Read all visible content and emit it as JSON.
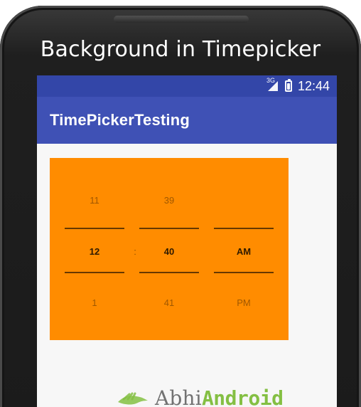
{
  "frame": {
    "title": "Background in Timepicker"
  },
  "status_bar": {
    "signal_label": "3G",
    "time": "12:44"
  },
  "app_bar": {
    "title": "TimePickerTesting"
  },
  "time_picker": {
    "hours": {
      "prev": "11",
      "selected": "12",
      "next": "1"
    },
    "minutes": {
      "prev": "39",
      "selected": "40",
      "next": "41"
    },
    "ampm": {
      "prev": "",
      "selected": "AM",
      "next": "PM"
    },
    "separator": ":"
  },
  "watermark": {
    "text_prefix": "Abhi",
    "text_accent": "Android"
  },
  "colors": {
    "status_bar": "#3346a8",
    "app_bar": "#3f51b5",
    "picker_background": "#ff8c00",
    "screen_background": "#f7f7f7",
    "watermark_accent": "#7ebd3a"
  }
}
